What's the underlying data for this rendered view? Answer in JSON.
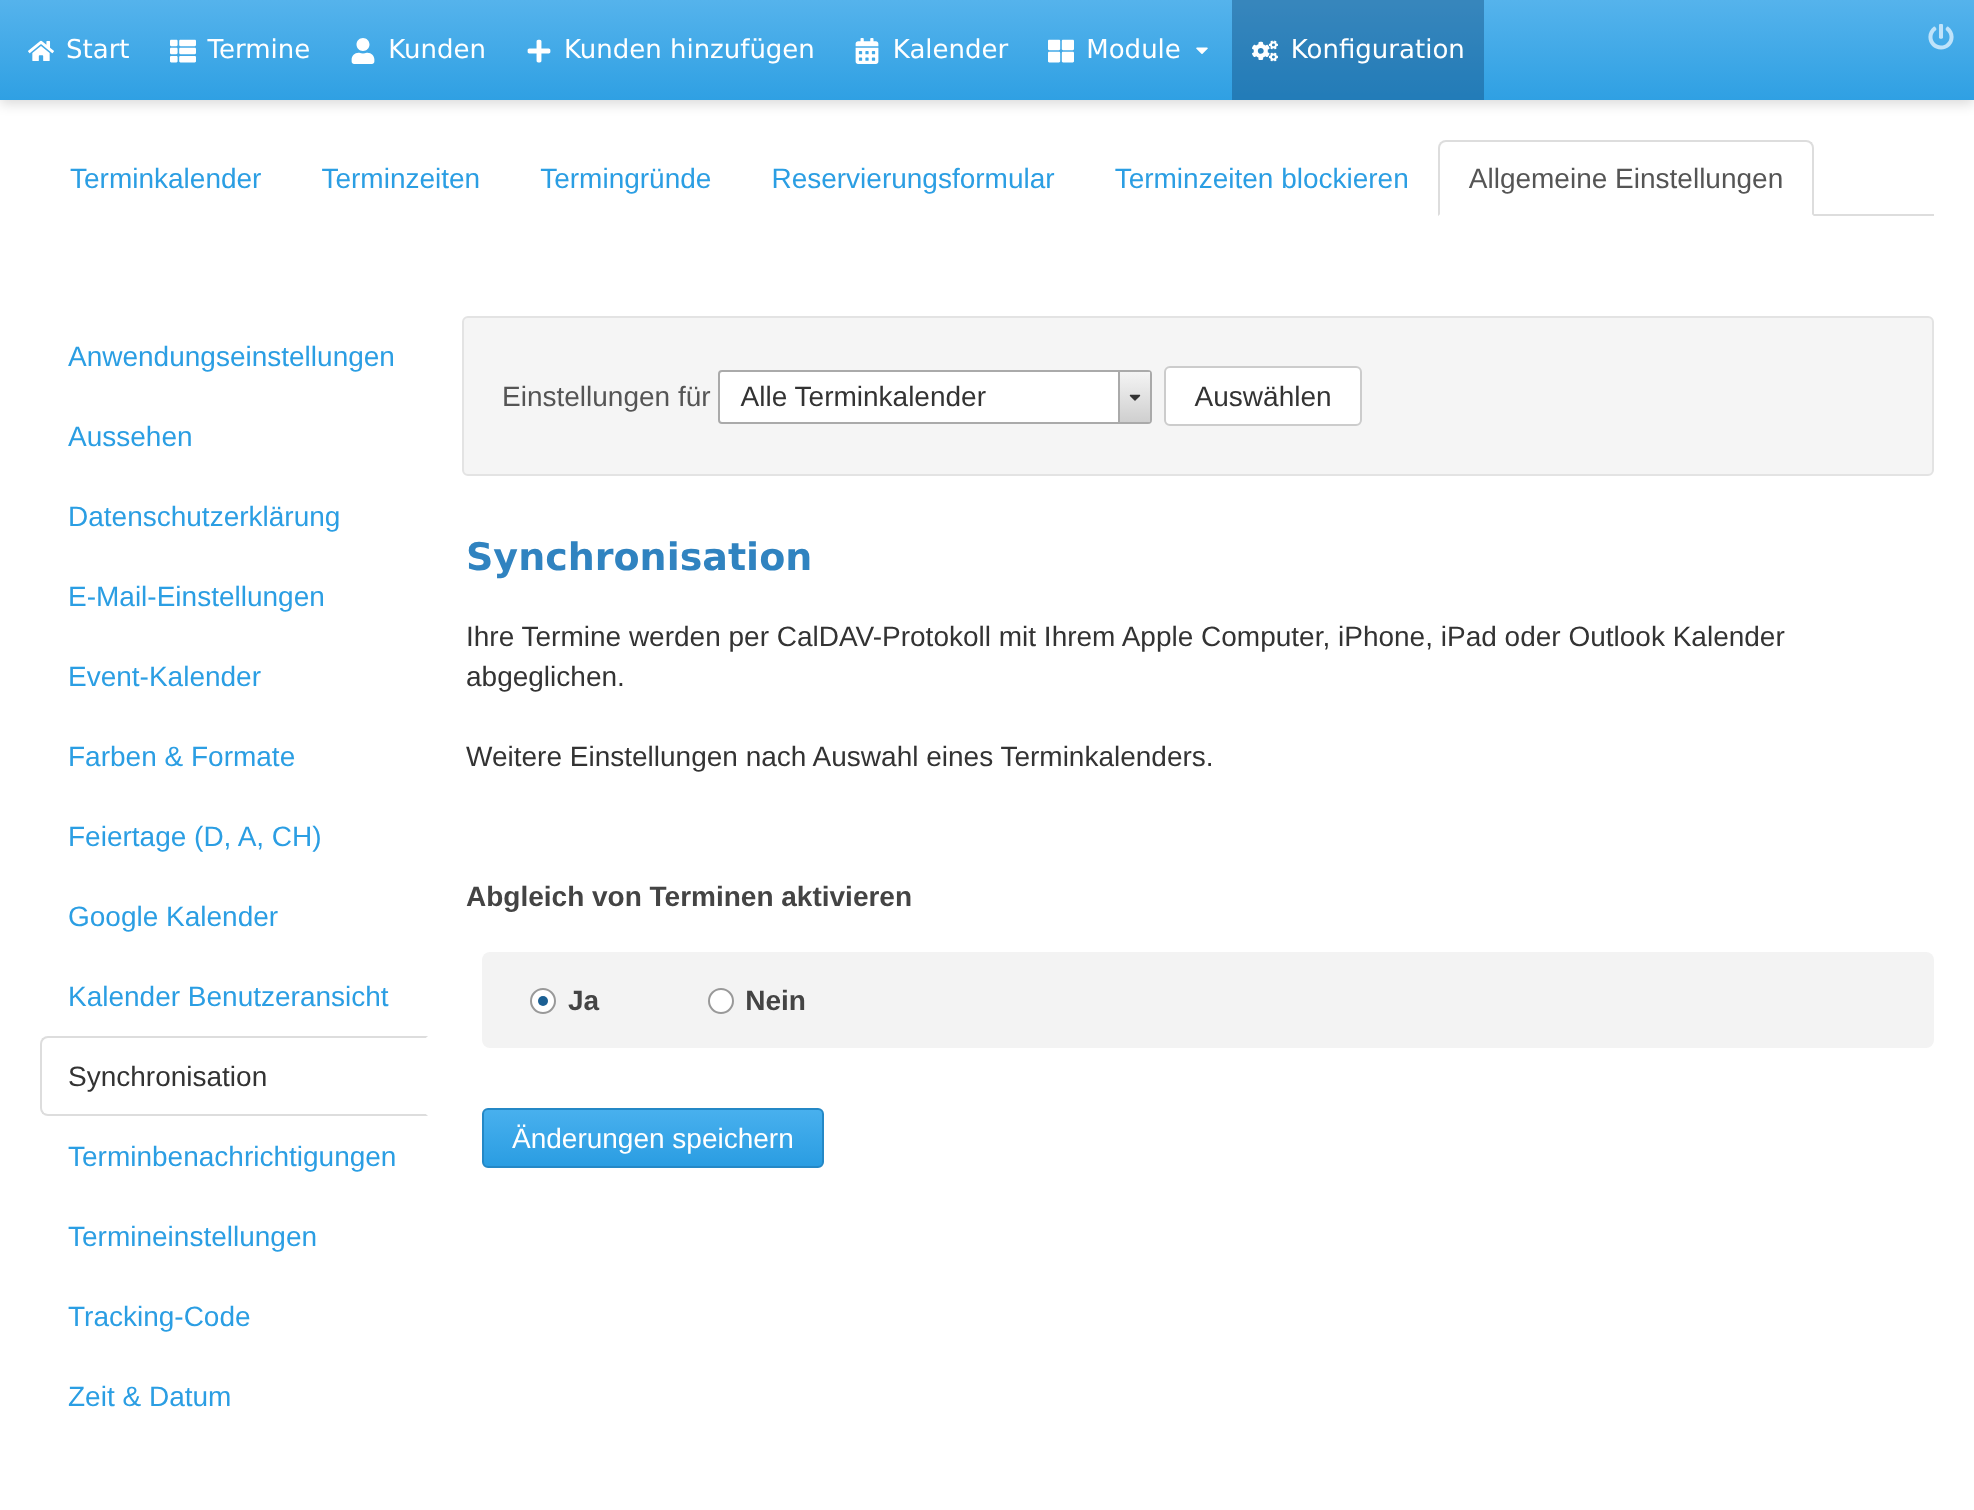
{
  "navbar": {
    "items": [
      {
        "label": "Start",
        "selected": false,
        "dropdown": false
      },
      {
        "label": "Termine",
        "selected": false,
        "dropdown": false
      },
      {
        "label": "Kunden",
        "selected": false,
        "dropdown": false
      },
      {
        "label": "Kunden hinzufügen",
        "selected": false,
        "dropdown": false
      },
      {
        "label": "Kalender",
        "selected": false,
        "dropdown": false
      },
      {
        "label": "Module",
        "selected": false,
        "dropdown": true
      },
      {
        "label": "Konfiguration",
        "selected": true,
        "dropdown": false
      }
    ]
  },
  "tabs": [
    {
      "label": "Terminkalender",
      "selected": false
    },
    {
      "label": "Terminzeiten",
      "selected": false
    },
    {
      "label": "Termingründe",
      "selected": false
    },
    {
      "label": "Reservierungsformular",
      "selected": false
    },
    {
      "label": "Terminzeiten blockieren",
      "selected": false
    },
    {
      "label": "Allgemeine Einstellungen",
      "selected": true
    }
  ],
  "sidebar": {
    "items": [
      {
        "label": "Anwendungseinstellungen",
        "selected": false
      },
      {
        "label": "Aussehen",
        "selected": false
      },
      {
        "label": "Datenschutzerklärung",
        "selected": false
      },
      {
        "label": "E-Mail-Einstellungen",
        "selected": false
      },
      {
        "label": "Event-Kalender",
        "selected": false
      },
      {
        "label": "Farben & Formate",
        "selected": false
      },
      {
        "label": "Feiertage (D, A, CH)",
        "selected": false
      },
      {
        "label": "Google Kalender",
        "selected": false
      },
      {
        "label": "Kalender Benutzeransicht",
        "selected": false
      },
      {
        "label": "Synchronisation",
        "selected": true
      },
      {
        "label": "Terminbenachrichtigungen",
        "selected": false
      },
      {
        "label": "Termineinstellungen",
        "selected": false
      },
      {
        "label": "Tracking-Code",
        "selected": false
      },
      {
        "label": "Zeit & Datum",
        "selected": false
      }
    ]
  },
  "filter": {
    "label": "Einstellungen für",
    "select_value": "Alle Terminkalender",
    "button": "Auswählen"
  },
  "section": {
    "title": "Synchronisation",
    "paragraphs": [
      "Ihre Termine werden per CalDAV-Protokoll mit Ihrem Apple Computer, iPhone, iPad oder Outlook Kalender abgeglichen.",
      "Weitere Einstellungen nach Auswahl eines Terminkalenders."
    ],
    "question": "Abgleich von Terminen aktivieren",
    "options": [
      {
        "label": "Ja",
        "selected": true
      },
      {
        "label": "Nein",
        "selected": false
      }
    ],
    "save_button": "Änderungen speichern"
  }
}
